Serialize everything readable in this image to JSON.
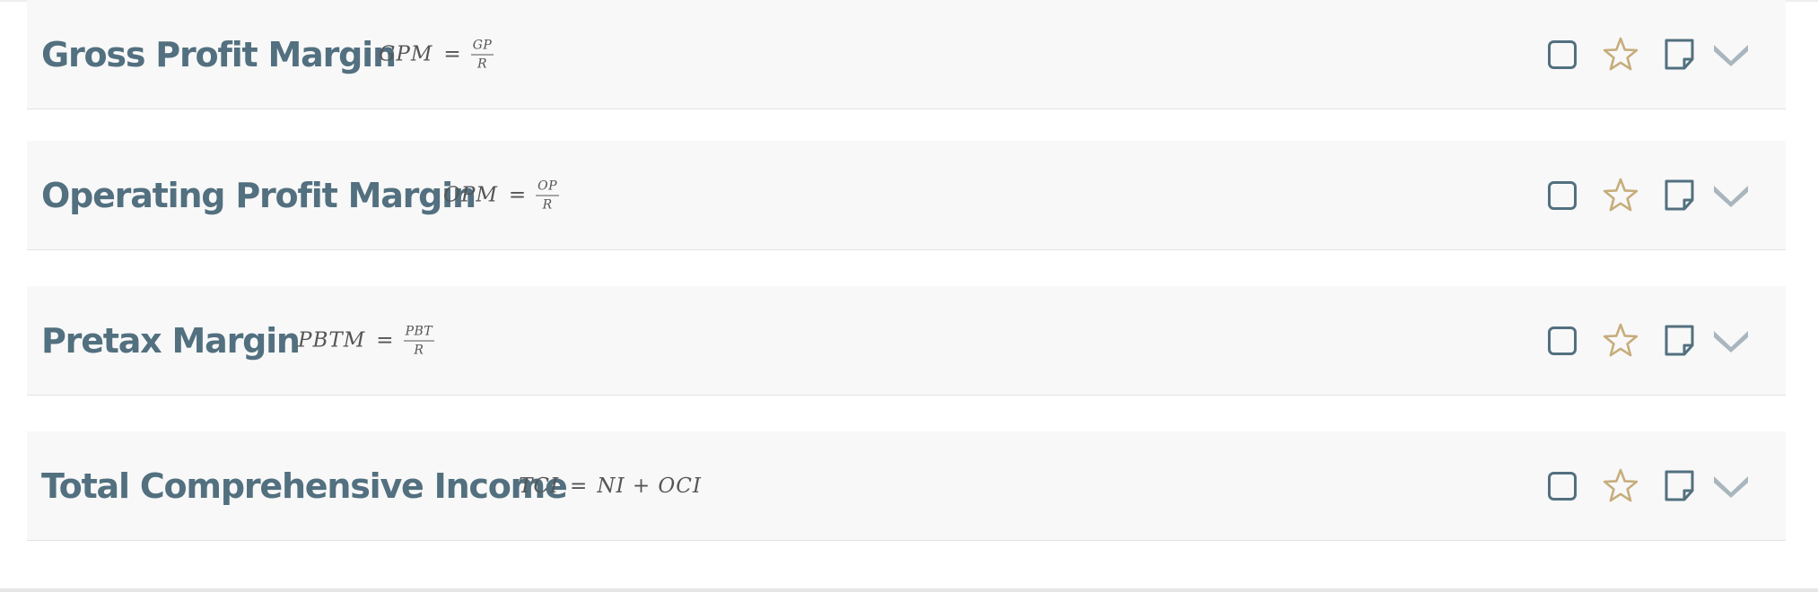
{
  "items": [
    {
      "title": "Gross Profit Margin",
      "formula": {
        "lhs": "GPM",
        "eq": "=",
        "num": "GP",
        "den": "R",
        "rhs": ""
      },
      "icons": {
        "checkbox": "checkbox-icon",
        "favorite": "star-icon",
        "note": "note-icon",
        "expand": "chevron-down-icon"
      }
    },
    {
      "title": "Operating Profit Margin",
      "formula": {
        "lhs": "OPM",
        "eq": "=",
        "num": "OP",
        "den": "R",
        "rhs": ""
      },
      "icons": {
        "checkbox": "checkbox-icon",
        "favorite": "star-icon",
        "note": "note-icon",
        "expand": "chevron-down-icon"
      }
    },
    {
      "title": "Pretax Margin",
      "formula": {
        "lhs": "PBTM",
        "eq": "=",
        "num": "PBT",
        "den": "R",
        "rhs": ""
      },
      "icons": {
        "checkbox": "checkbox-icon",
        "favorite": "star-icon",
        "note": "note-icon",
        "expand": "chevron-down-icon"
      }
    },
    {
      "title": "Total Comprehensive Income",
      "formula": {
        "lhs": "TCI",
        "eq": "=",
        "num": "",
        "den": "",
        "rhs": "NI + OCI"
      },
      "icons": {
        "checkbox": "checkbox-icon",
        "favorite": "star-icon",
        "note": "note-icon",
        "expand": "chevron-down-icon"
      }
    }
  ],
  "colors": {
    "title": "#52707f",
    "formula": "#555555",
    "card_bg": "#f8f8f8",
    "icon_slate": "#52707f",
    "star_gold": "#c6ad7b",
    "chevron_gray": "#a9b6bd"
  }
}
